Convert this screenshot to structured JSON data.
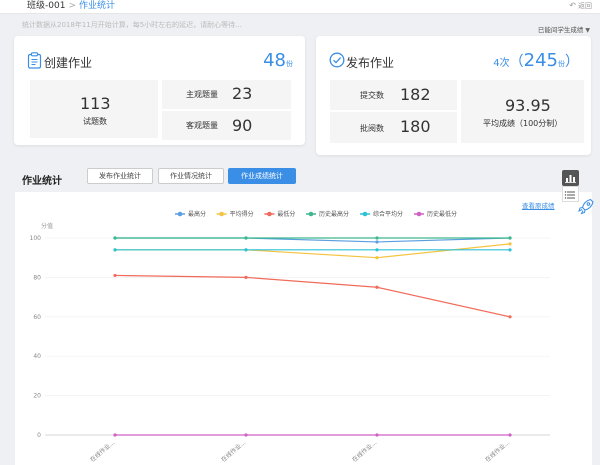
{
  "breadcrumb": {
    "class_name": "班级-001",
    "sep": ">",
    "current": "作业统计"
  },
  "back_label": "返回",
  "notice": "统计数据从2018年11月开始计算，每5小时左右的延迟，请耐心等待...",
  "selector": {
    "label": "已能间学生成绩"
  },
  "create_card": {
    "title": "创建作业",
    "count": "48",
    "unit": "份",
    "total_questions": {
      "value": "113",
      "label": "试题数"
    },
    "subjective": {
      "label": "主观题量",
      "value": "23"
    },
    "objective": {
      "label": "客观题量",
      "value": "90"
    }
  },
  "publish_card": {
    "title": "发布作业",
    "times": "4次",
    "count": "245",
    "unit": "份",
    "submitted": {
      "label": "提交数",
      "value": "182"
    },
    "graded": {
      "label": "批阅数",
      "value": "180"
    },
    "avg": {
      "value": "93.95",
      "label": "平均成绩（100分制）"
    }
  },
  "section_title": "作业统计",
  "tabs": [
    "发布作业统计",
    "作业情况统计",
    "作业成绩统计"
  ],
  "view_link": "查看原成绩",
  "colors": {
    "accent": "#3a8ee6"
  },
  "chart_data": {
    "type": "line",
    "ylabel": "分值",
    "ylim": [
      0,
      100
    ],
    "yticks": [
      0,
      20,
      40,
      60,
      80,
      100
    ],
    "categories": [
      "在线作业...",
      "在线作业...",
      "在线作业...",
      "在线作业..."
    ],
    "series": [
      {
        "name": "最高分",
        "color": "#5a9fe0",
        "values": [
          100,
          100,
          98,
          100
        ]
      },
      {
        "name": "平均得分",
        "color": "#f5c342",
        "values": [
          94,
          94,
          90,
          97
        ]
      },
      {
        "name": "最低分",
        "color": "#f06b5a",
        "values": [
          81,
          80,
          75,
          60
        ]
      },
      {
        "name": "历史最高分",
        "color": "#3cb88c",
        "values": [
          100,
          100,
          100,
          100
        ]
      },
      {
        "name": "综合平均分",
        "color": "#2bc2d8",
        "values": [
          94,
          94,
          94,
          94
        ]
      },
      {
        "name": "历史最低分",
        "color": "#d060c8",
        "values": [
          0,
          0,
          0,
          0
        ]
      }
    ]
  }
}
